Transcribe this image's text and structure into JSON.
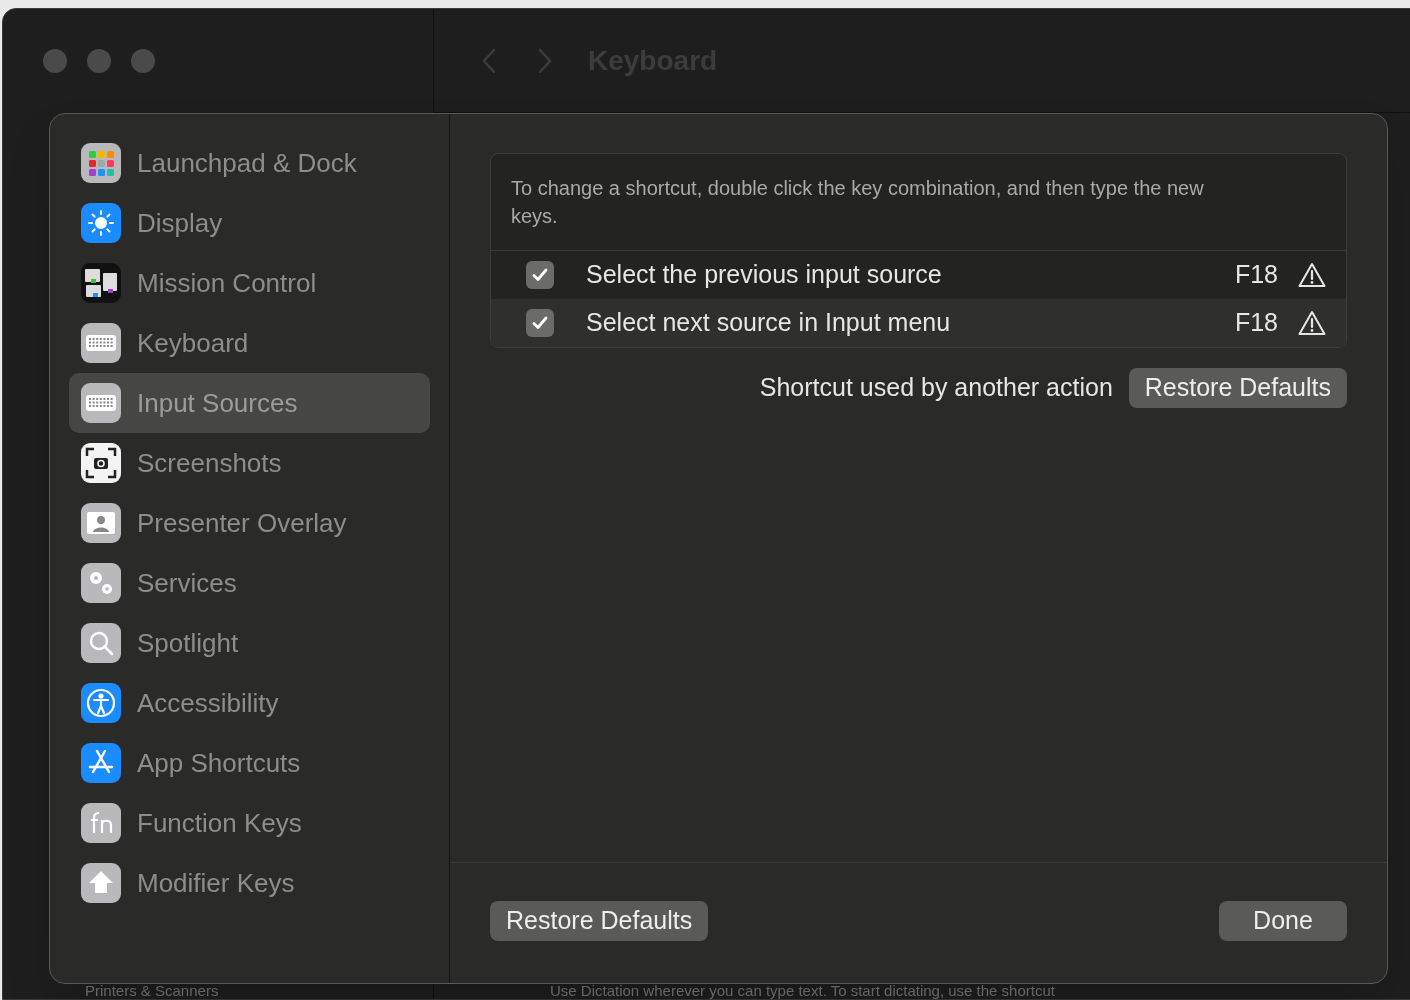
{
  "background_window": {
    "title": "Keyboard",
    "bottom_text": "Use Dictation wherever you can type text. To start dictating, use the shortcut",
    "sidebar_bottom_item": "Printers & Scanners"
  },
  "sidebar": {
    "items": [
      {
        "label": "Launchpad & Dock",
        "selected": false
      },
      {
        "label": "Display",
        "selected": false
      },
      {
        "label": "Mission Control",
        "selected": false
      },
      {
        "label": "Keyboard",
        "selected": false
      },
      {
        "label": "Input Sources",
        "selected": true
      },
      {
        "label": "Screenshots",
        "selected": false
      },
      {
        "label": "Presenter Overlay",
        "selected": false
      },
      {
        "label": "Services",
        "selected": false
      },
      {
        "label": "Spotlight",
        "selected": false
      },
      {
        "label": "Accessibility",
        "selected": false
      },
      {
        "label": "App Shortcuts",
        "selected": false
      },
      {
        "label": "Function Keys",
        "selected": false
      },
      {
        "label": "Modifier Keys",
        "selected": false
      }
    ]
  },
  "shortcuts": {
    "description": "To change a shortcut, double click the key combination, and then type the new keys.",
    "rows": [
      {
        "label": "Select the previous input source",
        "checked": true,
        "selected": false,
        "key": "F18",
        "conflict": true
      },
      {
        "label": "Select next source in Input menu",
        "checked": true,
        "selected": true,
        "key": "F18",
        "conflict": true
      }
    ],
    "conflict_message": "Shortcut used by another action",
    "restore_button": "Restore Defaults"
  },
  "footer": {
    "restore_button": "Restore Defaults",
    "done_button": "Done"
  }
}
